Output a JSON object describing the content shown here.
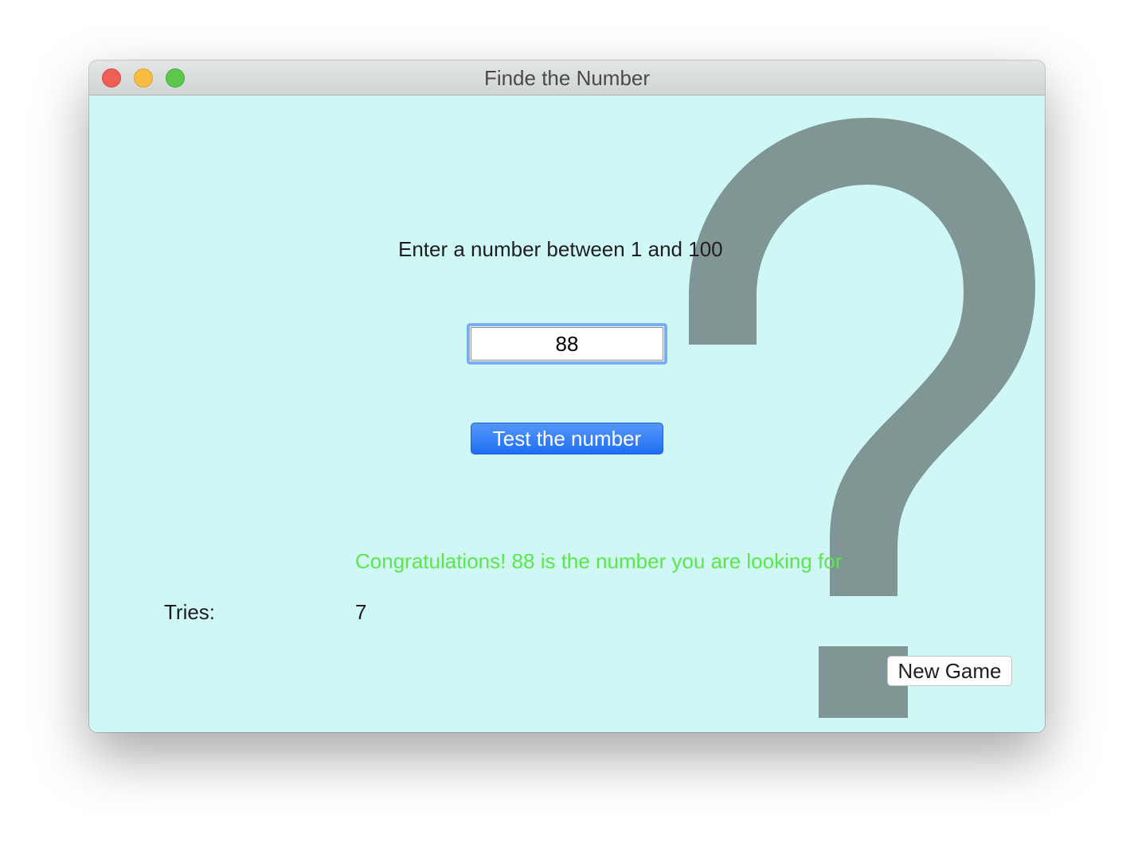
{
  "window": {
    "title": "Finde the Number"
  },
  "main": {
    "prompt": "Enter a number between 1 and 100",
    "input_value": "88",
    "test_button_label": "Test the number",
    "message": "Congratulations! 88 is the number you are looking for",
    "tries_label": "Tries:",
    "tries_value": "7",
    "new_game_label": "New Game"
  },
  "colors": {
    "background": "#cef7f5",
    "question_mark": "#7f9694",
    "success_text": "#5ce64b",
    "primary_button": "#2a78f5"
  },
  "icons": {
    "background_graphic": "question-mark-icon"
  }
}
